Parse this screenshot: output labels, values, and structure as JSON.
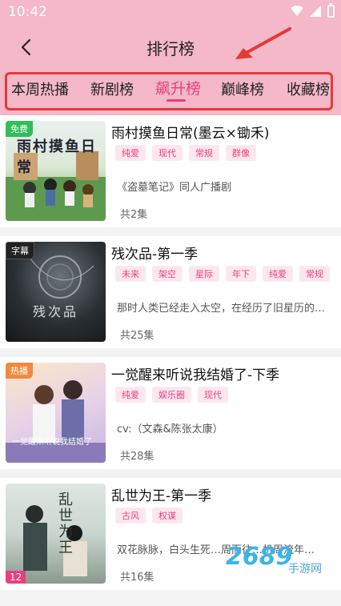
{
  "status": {
    "time": "10:42"
  },
  "header": {
    "title": "排行榜"
  },
  "tabs": [
    {
      "label": "本周热播"
    },
    {
      "label": "新剧榜"
    },
    {
      "label": "飙升榜"
    },
    {
      "label": "巅峰榜"
    },
    {
      "label": "收藏榜"
    }
  ],
  "items": [
    {
      "title": "雨村摸鱼日常(墨云×锄禾)",
      "badge": "免费",
      "cover_text": "雨村摸鱼日常",
      "tags": [
        "纯爱",
        "现代",
        "常规",
        "群像"
      ],
      "desc": "《盗墓笔记》同人广播剧",
      "episodes": "共2集"
    },
    {
      "title": "残次品-第一季",
      "badge": "字幕",
      "cover_text": "残次品",
      "tags": [
        "未来",
        "架空",
        "星际",
        "年下",
        "纯爱",
        "常规"
      ],
      "desc": "那时人类已经走入太空，在经历了旧星历的…",
      "episodes": "共25集"
    },
    {
      "title": "一觉醒来听说我结婚了-下季",
      "badge": "热播",
      "cover_text": "一觉醒来听说我结婚了",
      "tags": [
        "纯爱",
        "娱乐圈",
        "现代"
      ],
      "desc": "cv:（文森&陈张太康）",
      "episodes": "共28集"
    },
    {
      "title": "乱世为王-第一季",
      "badge": "12",
      "cover_text": "乱世为王",
      "tags": [
        "古风",
        "权谋"
      ],
      "desc": "双花脉脉，白头生死…周而往…机周流年…",
      "episodes": "共16集"
    }
  ],
  "watermark": {
    "text": "2689",
    "sub": "手游网"
  },
  "colors": {
    "brand_pink": "#f4b8c8",
    "accent": "#ec3d7c",
    "highlight_red": "#e33a3a"
  }
}
